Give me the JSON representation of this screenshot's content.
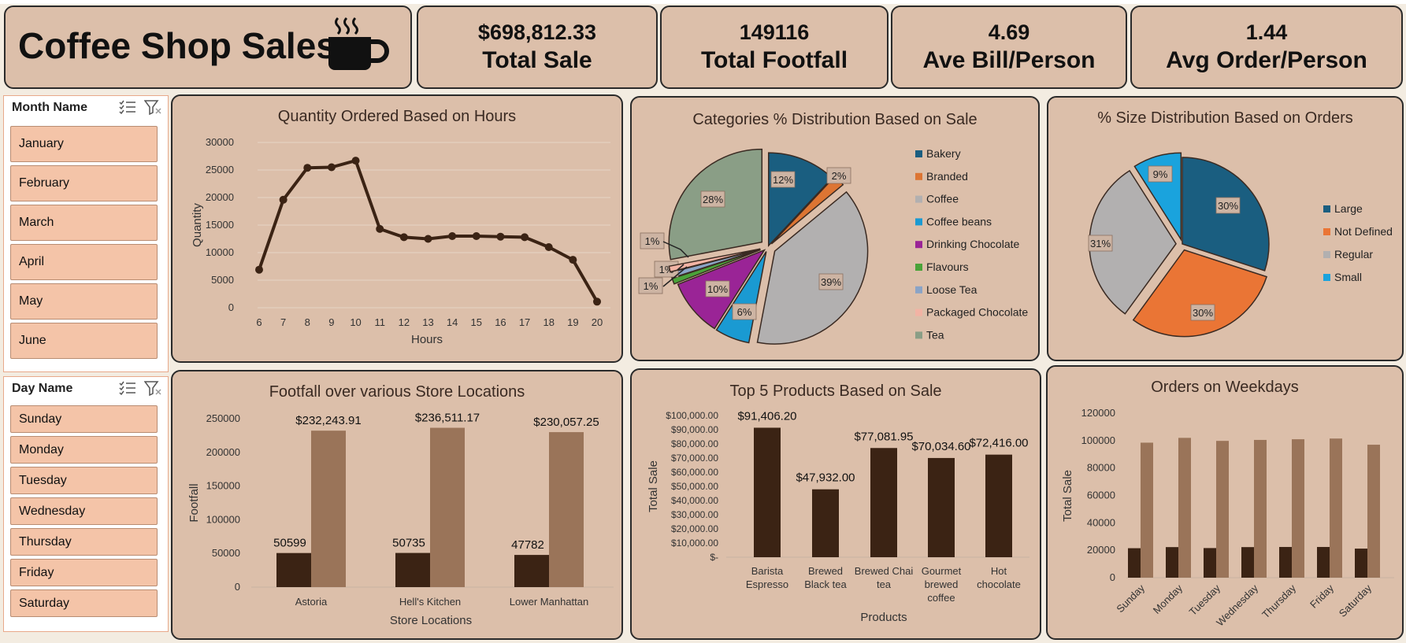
{
  "header": {
    "title": "Coffee Shop Sales"
  },
  "kpis": [
    {
      "value": "$698,812.33",
      "label": "Total Sale"
    },
    {
      "value": "149116",
      "label": "Total Footfall"
    },
    {
      "value": "4.69",
      "label": "Ave Bill/Person"
    },
    {
      "value": "1.44",
      "label": "Avg Order/Person"
    }
  ],
  "month_slicer": {
    "title": "Month Name",
    "items": [
      "January",
      "February",
      "March",
      "April",
      "May",
      "June"
    ]
  },
  "day_slicer": {
    "title": "Day Name",
    "items": [
      "Sunday",
      "Monday",
      "Tuesday",
      "Wednesday",
      "Thursday",
      "Friday",
      "Saturday"
    ]
  },
  "colors": {
    "panel": "#dcbfaa",
    "dark": "#3b2314",
    "light": "#9a7459",
    "slicer_item": "#f4c4a8"
  },
  "chart_data": [
    {
      "id": "hours",
      "type": "line",
      "title": "Quantity Ordered Based on Hours",
      "xlabel": "Hours",
      "ylabel": "Quantity",
      "ylim": [
        0,
        30000
      ],
      "yticks": [
        "30000",
        "25000",
        "20000",
        "15000",
        "10000",
        "5000",
        "0"
      ],
      "x": [
        "6",
        "7",
        "8",
        "9",
        "10",
        "11",
        "12",
        "13",
        "14",
        "15",
        "16",
        "17",
        "18",
        "19",
        "20"
      ],
      "values": [
        6900,
        19600,
        25400,
        25500,
        26700,
        14300,
        12800,
        12500,
        13000,
        13000,
        12900,
        12800,
        11000,
        8700,
        1100
      ],
      "grid": true
    },
    {
      "id": "categories",
      "type": "pie",
      "title": "Categories % Distribution Based on Sale",
      "legend": "right",
      "slices": [
        {
          "name": "Bakery",
          "value": 12,
          "label": "12%",
          "color": "#1a5e80"
        },
        {
          "name": "Branded",
          "value": 2,
          "label": "2%",
          "color": "#dd7533"
        },
        {
          "name": "Coffee",
          "value": 39,
          "label": "39%",
          "color": "#b2b0b0"
        },
        {
          "name": "Coffee beans",
          "value": 6,
          "label": "6%",
          "color": "#1a9ad2"
        },
        {
          "name": "Drinking Chocolate",
          "value": 10,
          "label": "10%",
          "color": "#9a2496"
        },
        {
          "name": "Flavours",
          "value": 1,
          "label": "1%",
          "color": "#4aa339"
        },
        {
          "name": "Loose Tea",
          "value": 1,
          "label": "1%",
          "color": "#8aa4c6"
        },
        {
          "name": "Packaged Chocolate",
          "value": 1,
          "label": "1%",
          "color": "#f2b3a4"
        },
        {
          "name": "Tea",
          "value": 28,
          "label": "28%",
          "color": "#8a9e86"
        }
      ]
    },
    {
      "id": "sizes",
      "type": "pie",
      "title": "% Size Distribution Based on Orders",
      "legend": "right",
      "slices": [
        {
          "name": "Large",
          "value": 30,
          "label": "30%",
          "color": "#1a5e80"
        },
        {
          "name": "Not Defined",
          "value": 30,
          "label": "30%",
          "color": "#ea7535"
        },
        {
          "name": "Regular",
          "value": 31,
          "label": "31%",
          "color": "#b2b0b0"
        },
        {
          "name": "Small",
          "value": 9,
          "label": "9%",
          "color": "#1aa3dd"
        }
      ]
    },
    {
      "id": "footfall",
      "type": "bar",
      "title": "Footfall over various Store Locations",
      "xlabel": "Store Locations",
      "ylabel": "Footfall",
      "ylim": [
        0,
        250000
      ],
      "yticks": [
        "250000",
        "200000",
        "150000",
        "100000",
        "50000",
        "0"
      ],
      "categories": [
        "Astoria",
        "Hell's Kitchen",
        "Lower Manhattan"
      ],
      "series": [
        {
          "values": [
            50599,
            50735,
            47782
          ],
          "labels": [
            "50599",
            "50735",
            "47782"
          ]
        },
        {
          "values": [
            232243.91,
            236511.17,
            230057.25
          ],
          "labels": [
            "$232,243.91",
            "$236,511.17",
            "$230,057.25"
          ]
        }
      ]
    },
    {
      "id": "products",
      "type": "bar",
      "title": "Top 5 Products Based on Sale",
      "xlabel": "Products",
      "ylabel": "Total Sale",
      "ylim": [
        0,
        100000
      ],
      "yticks": [
        "$100,000.00",
        "$90,000.00",
        "$80,000.00",
        "$70,000.00",
        "$60,000.00",
        "$50,000.00",
        "$40,000.00",
        "$30,000.00",
        "$20,000.00",
        "$10,000.00",
        "$-"
      ],
      "categories": [
        [
          "Barista",
          "Espresso"
        ],
        [
          "Brewed",
          "Black tea"
        ],
        [
          "Brewed Chai",
          "tea"
        ],
        [
          "Gourmet",
          "brewed",
          "coffee"
        ],
        [
          "Hot",
          "chocolate"
        ]
      ],
      "values": [
        91406.2,
        47932.0,
        77081.95,
        70034.6,
        72416.0
      ],
      "labels": [
        "$91,406.20",
        "$47,932.00",
        "$77,081.95",
        "$70,034.60",
        "$72,416.00"
      ]
    },
    {
      "id": "weekdays",
      "type": "bar",
      "title": "Orders on Weekdays",
      "ylabel": "Total Sale",
      "ylim": [
        0,
        120000
      ],
      "yticks": [
        "120000",
        "100000",
        "80000",
        "60000",
        "40000",
        "20000",
        "0"
      ],
      "categories": [
        "Sunday",
        "Monday",
        "Tuesday",
        "Wednesday",
        "Thursday",
        "Friday",
        "Saturday"
      ],
      "series": [
        {
          "values": [
            21500,
            22300,
            21600,
            22300,
            22400,
            22400,
            21200
          ]
        },
        {
          "values": [
            98500,
            102000,
            99800,
            100500,
            101000,
            101500,
            97000
          ]
        }
      ]
    }
  ]
}
